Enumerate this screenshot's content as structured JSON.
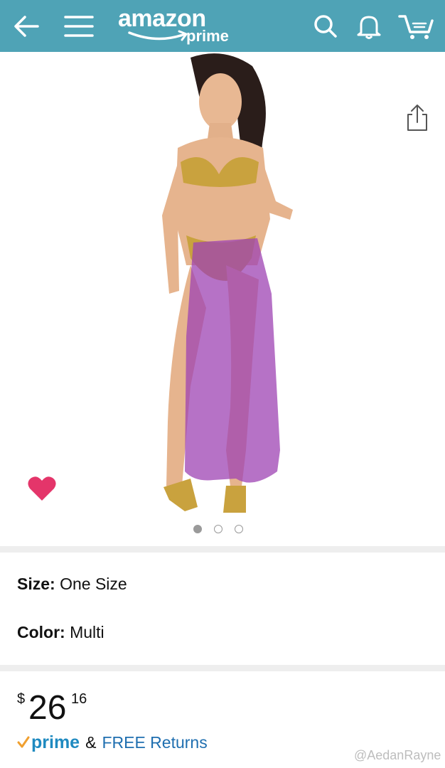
{
  "header": {
    "logo_word": "amazon",
    "logo_sub": "prime",
    "icons": [
      "back-arrow-icon",
      "menu-icon",
      "search-icon",
      "bell-icon",
      "cart-icon"
    ],
    "background_color": "#4fa3b6"
  },
  "gallery": {
    "image_count": 3,
    "active_index": 0,
    "favorite_color": "#e4356a"
  },
  "details": {
    "size_label": "Size:",
    "size_value": "One Size",
    "color_label": "Color:",
    "color_value": "Multi"
  },
  "price": {
    "currency": "$",
    "whole": "26",
    "fraction": "16"
  },
  "shipping": {
    "prime_check": "✓",
    "prime_word": "prime",
    "ampersand": "&",
    "returns_text": "FREE Returns"
  },
  "watermark": "@AedanRayne"
}
